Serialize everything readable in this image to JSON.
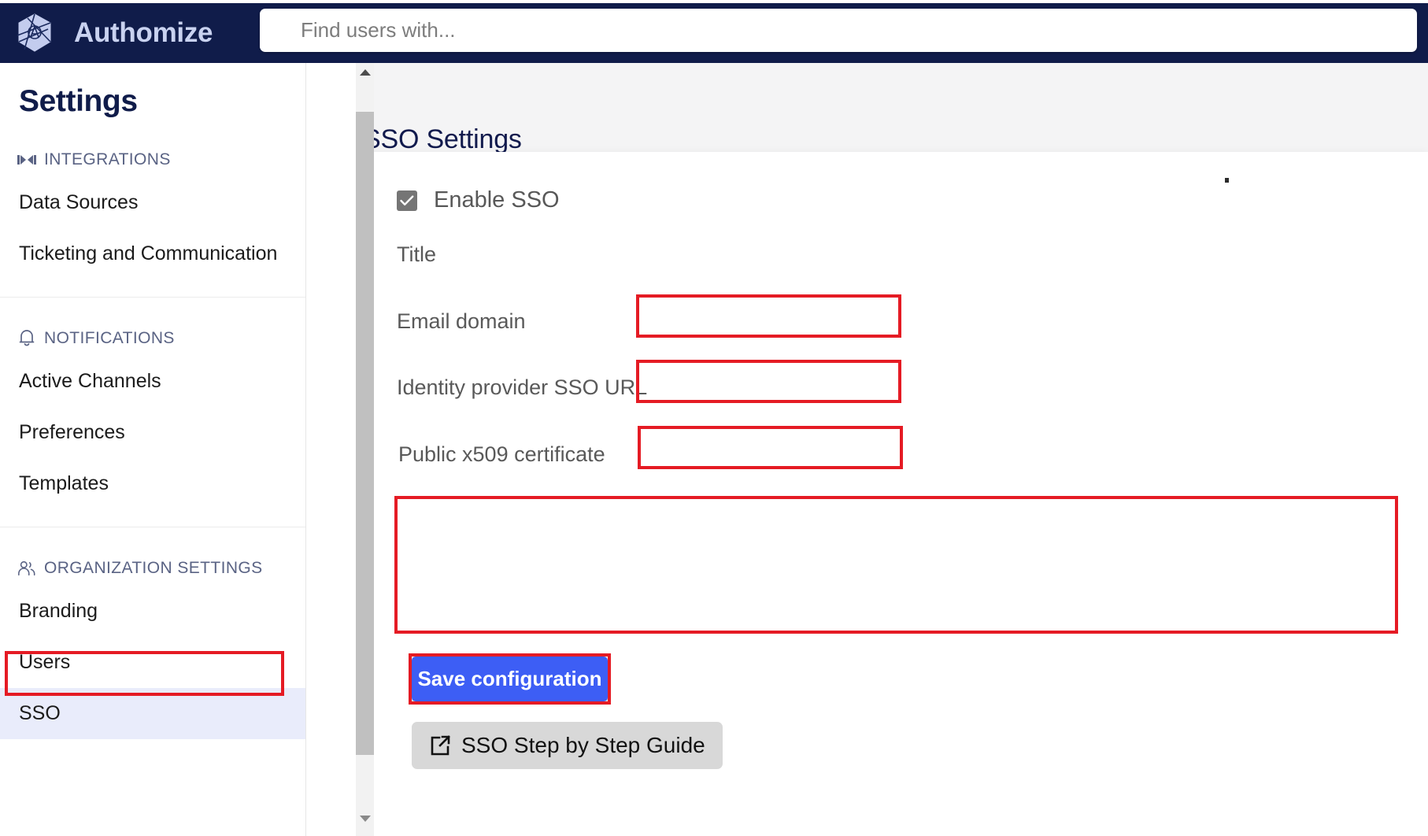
{
  "topbar": {
    "brand": "Authomize",
    "logo_icon": "authomize-polygon-logo-icon",
    "search": {
      "placeholder": "Find users with...",
      "value": ""
    }
  },
  "sidebar": {
    "title": "Settings",
    "groups": [
      {
        "label": "INTEGRATIONS",
        "icon": "integrations-connector-icon",
        "items": [
          {
            "label": "Data Sources",
            "active": false
          },
          {
            "label": "Ticketing and Communication",
            "active": false
          }
        ]
      },
      {
        "label": "NOTIFICATIONS",
        "icon": "bell-icon",
        "items": [
          {
            "label": "Active Channels",
            "active": false
          },
          {
            "label": "Preferences",
            "active": false
          },
          {
            "label": "Templates",
            "active": false
          }
        ]
      },
      {
        "label": "ORGANIZATION SETTINGS",
        "icon": "users-icon",
        "items": [
          {
            "label": "Branding",
            "active": false
          },
          {
            "label": "Users",
            "active": false
          },
          {
            "label": "SSO",
            "active": true
          }
        ]
      }
    ],
    "scrollbar": {
      "up_icon": "triangle-up-icon",
      "down_icon": "triangle-down-icon"
    }
  },
  "main": {
    "page_title": "SSO Settings",
    "enable_sso": {
      "label": "Enable SSO",
      "checked": true,
      "check_icon": "checkmark-icon"
    },
    "fields": [
      {
        "label": "Title",
        "value": "",
        "placeholder": ""
      },
      {
        "label": "Email domain",
        "value": "",
        "placeholder": ""
      },
      {
        "label": "Identity provider SSO URL",
        "value": "",
        "placeholder": ""
      },
      {
        "label": "Public x509 certificate",
        "value": "",
        "placeholder": ""
      }
    ],
    "save_button": "Save configuration",
    "guide_button": {
      "label": "SSO Step by Step Guide",
      "icon": "external-link-icon"
    }
  },
  "annotations": {
    "accent_color": "#e51b24",
    "boxes": [
      {
        "name": "sso-nav-highlight"
      },
      {
        "name": "title-input-highlight"
      },
      {
        "name": "email-domain-input-highlight"
      },
      {
        "name": "idp-sso-url-input-highlight"
      },
      {
        "name": "certificate-input-highlight"
      },
      {
        "name": "save-button-highlight"
      }
    ]
  },
  "colors": {
    "brand_navy": "#101C4A",
    "brand_text": "#C9D2F0",
    "save_blue": "#3D5EF5",
    "active_nav_bg": "#e9ecfb",
    "annotation_red": "#e51b24"
  }
}
